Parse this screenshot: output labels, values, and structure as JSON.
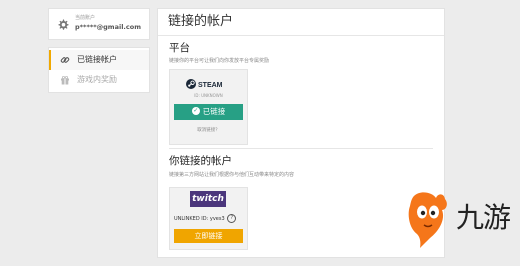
{
  "account": {
    "label": "当前账户",
    "email": "p*****@gmail.com",
    "gear_icon": "gear-icon"
  },
  "nav": {
    "items": [
      {
        "label": "已链接帐户",
        "icon": "link-icon",
        "active": true
      },
      {
        "label": "游戏内奖励",
        "icon": "gift-icon",
        "active": false
      }
    ],
    "accent": "#f0a800"
  },
  "main": {
    "title": "链接的帐户",
    "platform": {
      "title": "平台",
      "description": "链接你的平台可让我们向你发放平台专属奖励",
      "steam": {
        "logo_text": "STEAM",
        "id_text": "ID: UNKNOWN",
        "button_label": "已链接",
        "unlink_label": "取消链接？",
        "button_color": "#27a085"
      }
    },
    "your_accounts": {
      "title": "你链接的帐户",
      "description": "链接第三方网站让我们根据你与他们互动带来特定的内容",
      "twitch": {
        "logo_text": "twitch",
        "id_text": "UNLINKED ID: yves3",
        "help_icon": "?",
        "button_label": "立即链接",
        "button_color": "#f0a500"
      }
    }
  },
  "watermark": {
    "text": "九游",
    "logo_color": "#f5761a"
  }
}
